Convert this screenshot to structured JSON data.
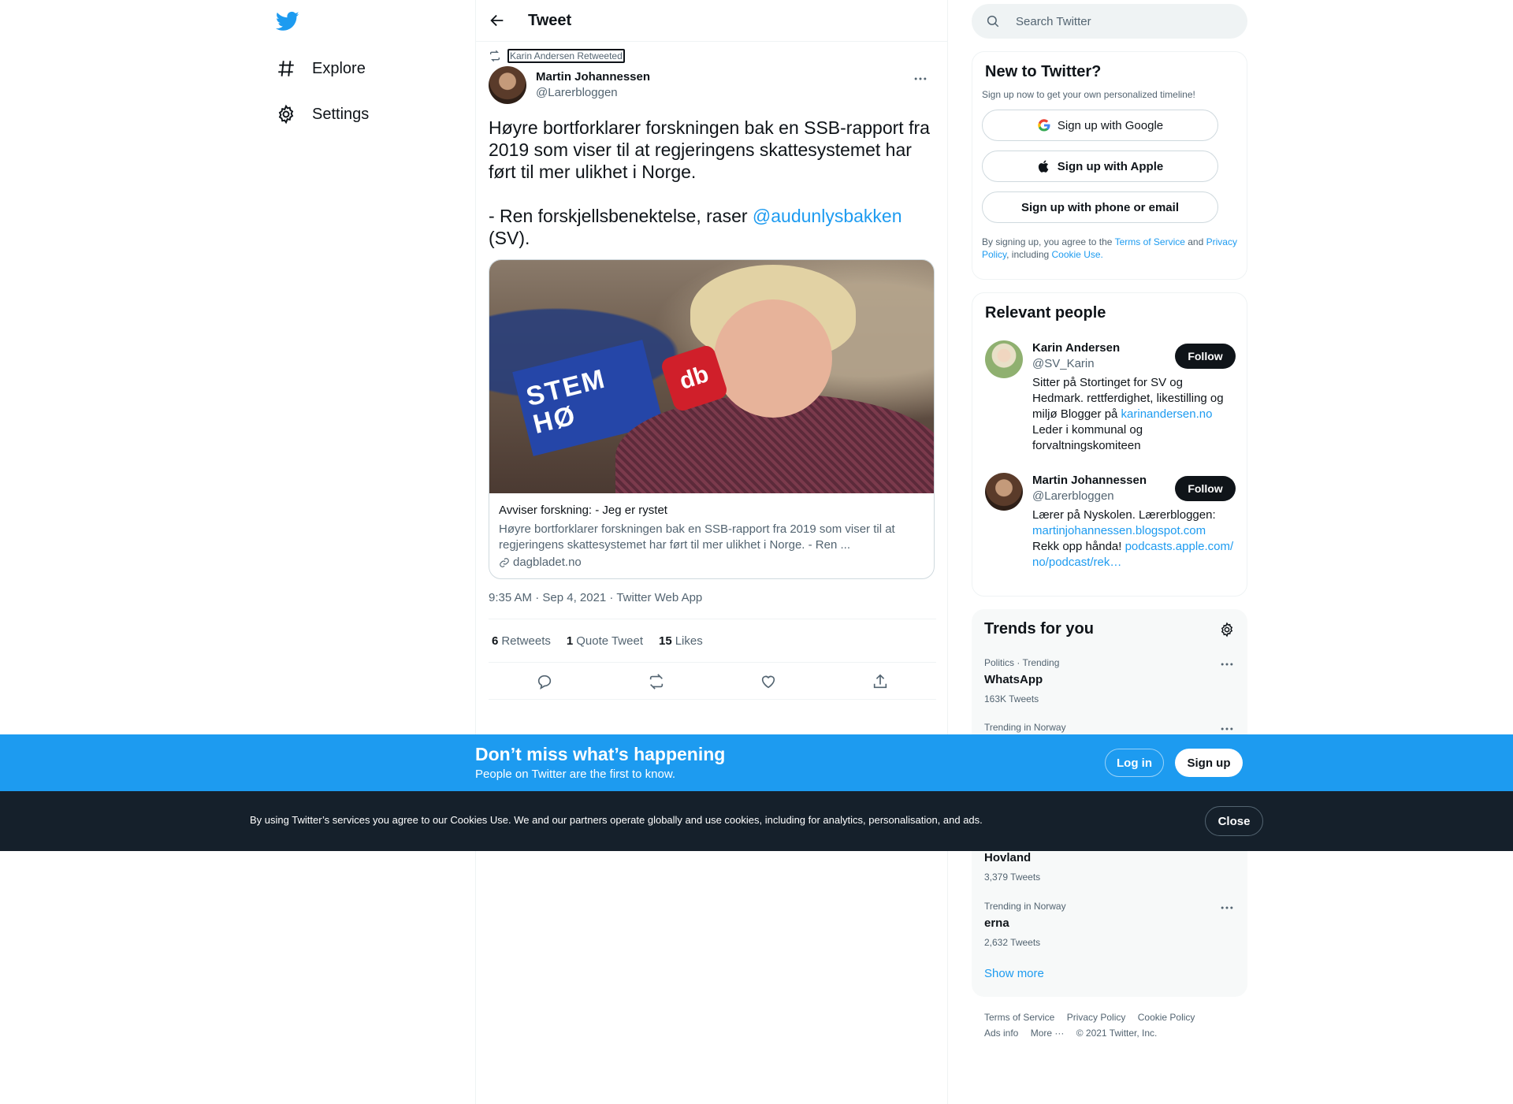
{
  "nav": {
    "items": [
      {
        "label": "Explore",
        "icon": "hashtag-icon"
      },
      {
        "label": "Settings",
        "icon": "gear-icon"
      }
    ]
  },
  "header": {
    "title": "Tweet"
  },
  "tweet": {
    "retweeted_by": "Karin Andersen Retweeted",
    "author_name": "Martin Johannessen",
    "author_handle": "@Larerbloggen",
    "text_para1": "Høyre bortforklarer forskningen bak en SSB-rapport fra 2019 som viser til at regjeringens skattesystemet har ført til mer ulikhet i Norge.",
    "text_para2_prefix": "- Ren forskjellsbenektelse, raser ",
    "text_mention": "@audunlysbakken",
    "text_para2_suffix": "(SV).",
    "card": {
      "image_sign_text": "STEM HØ",
      "image_mic_text": "db",
      "title": "Avviser forskning: - Jeg er rystet",
      "description": "Høyre bortforklarer forskningen bak en SSB-rapport fra 2019 som viser til at regjeringens skattesystemet har ført til mer ulikhet i Norge. - Ren ...",
      "domain": "dagbladet.no"
    },
    "timestamp": "9:35 AM · Sep 4, 2021 · Twitter Web App",
    "stats": {
      "retweets_count": "6",
      "retweets_label": "Retweets",
      "quotes_count": "1",
      "quotes_label": "Quote Tweet",
      "likes_count": "15",
      "likes_label": "Likes"
    }
  },
  "search": {
    "placeholder": "Search Twitter"
  },
  "new_to_twitter": {
    "title": "New to Twitter?",
    "subtitle": "Sign up now to get your own personalized timeline!",
    "google": "Sign up with Google",
    "apple": "Sign up with Apple",
    "phone": "Sign up with phone or email",
    "legal_1": "By signing up, you agree to the ",
    "terms": "Terms of Service",
    "legal_2": " and ",
    "privacy": "Privacy Policy",
    "legal_3": ", including ",
    "cookie": "Cookie Use."
  },
  "relevant_people": {
    "title": "Relevant people",
    "people": [
      {
        "name": "Karin Andersen",
        "handle": "@SV_Karin",
        "bio_1": "Sitter på Stortinget for SV og Hedmark. rettferdighet, likestilling og miljø Blogger på ",
        "bio_link": "karinandersen.no",
        "bio_2": " Leder i kommunal og forvaltningskomiteen",
        "follow": "Follow"
      },
      {
        "name": "Martin Johannessen",
        "handle": "@Larerbloggen",
        "bio_1": "Lærer på Nyskolen. Lærerbloggen: ",
        "bio_link": "martinjohannessen.blogspot.com",
        "bio_2": " Rekk opp hånda! ",
        "bio_link2": "podcasts.apple.com/no/podcast/rek…",
        "follow": "Follow"
      }
    ]
  },
  "trends": {
    "title": "Trends for you",
    "items": [
      {
        "meta": "Politics · Trending",
        "name": "WhatsApp",
        "count": "163K Tweets"
      },
      {
        "meta": "Trending in Norway",
        "name": "",
        "count": ""
      },
      {
        "meta": "",
        "name": "Hovland",
        "count": "3,379 Tweets"
      },
      {
        "meta": "Trending in Norway",
        "name": "erna",
        "count": "2,632 Tweets"
      }
    ],
    "show_more": "Show more"
  },
  "footer": {
    "terms": "Terms of Service",
    "privacy": "Privacy Policy",
    "cookie": "Cookie Policy",
    "ads": "Ads info",
    "more": "More ···",
    "copyright": "© 2021 Twitter, Inc."
  },
  "banner": {
    "title": "Don’t miss what’s happening",
    "subtitle": "People on Twitter are the first to know.",
    "login": "Log in",
    "signup": "Sign up"
  },
  "cookie_bar": {
    "text": "By using Twitter’s services you agree to our Cookies Use. We and our partners operate globally and use cookies, including for analytics, personalisation, and ads.",
    "close": "Close"
  },
  "colors": {
    "accent": "#1d9bf0",
    "text": "#0f1419",
    "secondary": "#536471",
    "cookie_bg": "#15202b"
  }
}
